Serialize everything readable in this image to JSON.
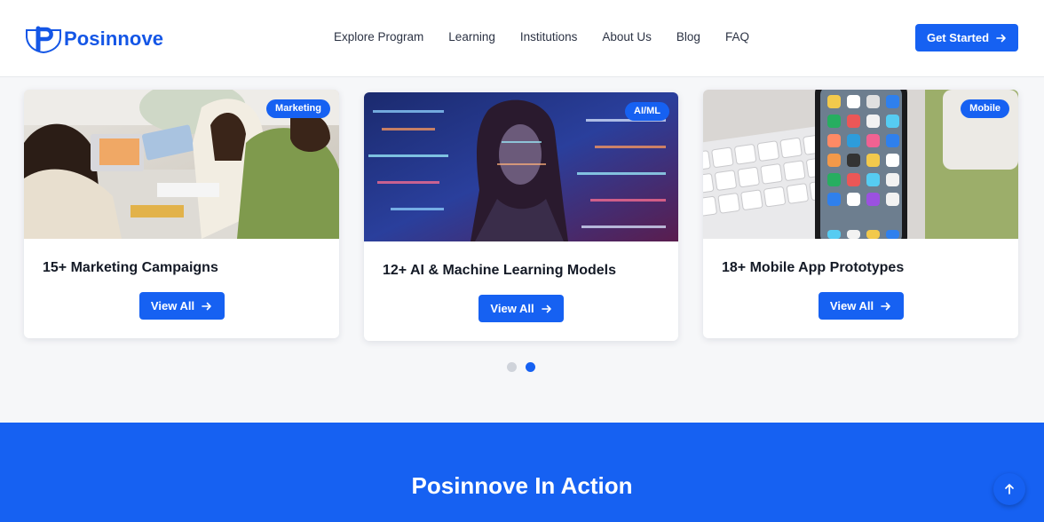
{
  "brand": {
    "name": "Posinnove",
    "color": "#1456e6"
  },
  "nav": {
    "items": [
      {
        "label": "Explore Program"
      },
      {
        "label": "Learning"
      },
      {
        "label": "Institutions"
      },
      {
        "label": "About Us"
      },
      {
        "label": "Blog"
      },
      {
        "label": "FAQ"
      }
    ]
  },
  "header": {
    "cta_label": "Get Started",
    "cta_icon": "arrow-right-icon"
  },
  "cards": [
    {
      "badge": "Marketing",
      "title": "15+ Marketing Campaigns",
      "button": "View All",
      "image": "team-meeting-laptop-photo"
    },
    {
      "badge": "AI/ML",
      "title": "12+ AI & Machine Learning Models",
      "button": "View All",
      "image": "woman-code-projection-photo"
    },
    {
      "badge": "Mobile",
      "title": "18+ Mobile App Prototypes",
      "button": "View All",
      "image": "smartphone-keyboard-photo"
    }
  ],
  "carousel": {
    "pages": 2,
    "active_page": 2
  },
  "action_section": {
    "title": "Posinnove In Action"
  },
  "colors": {
    "accent": "#1661f2",
    "background": "#f6f7f9",
    "text": "#141a26"
  }
}
